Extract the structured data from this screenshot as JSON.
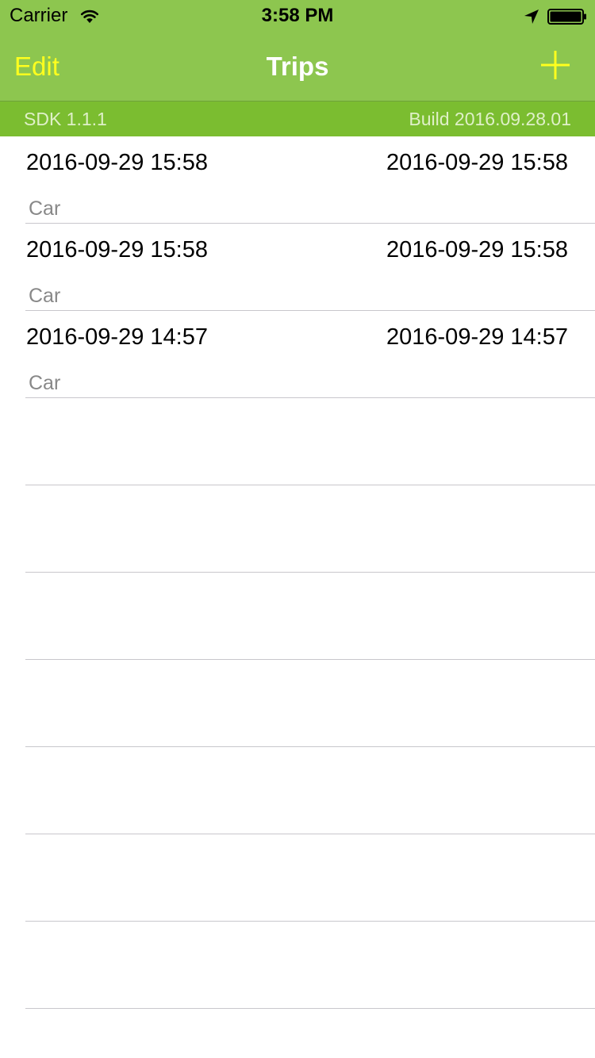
{
  "status_bar": {
    "carrier": "Carrier",
    "time": "3:58 PM",
    "icons": [
      "wifi-icon",
      "location-arrow-icon",
      "battery-icon"
    ]
  },
  "nav": {
    "edit_label": "Edit",
    "title": "Trips",
    "add_icon": "plus-icon"
  },
  "info_bar": {
    "sdk": "SDK 1.1.1",
    "build": "Build 2016.09.28.01"
  },
  "trips": [
    {
      "start": "2016-09-29 15:58",
      "end": "2016-09-29 15:58",
      "mode": "Car"
    },
    {
      "start": "2016-09-29 15:58",
      "end": "2016-09-29 15:58",
      "mode": "Car"
    },
    {
      "start": "2016-09-29 14:57",
      "end": "2016-09-29 14:57",
      "mode": "Car"
    }
  ],
  "colors": {
    "nav_background": "#8dc64f",
    "info_bar_background": "#7bbd30",
    "nav_button_tint": "#ffff1e",
    "title_color": "#ffffff",
    "subtitle_gray": "#888888",
    "separator": "#c8c7cc"
  }
}
